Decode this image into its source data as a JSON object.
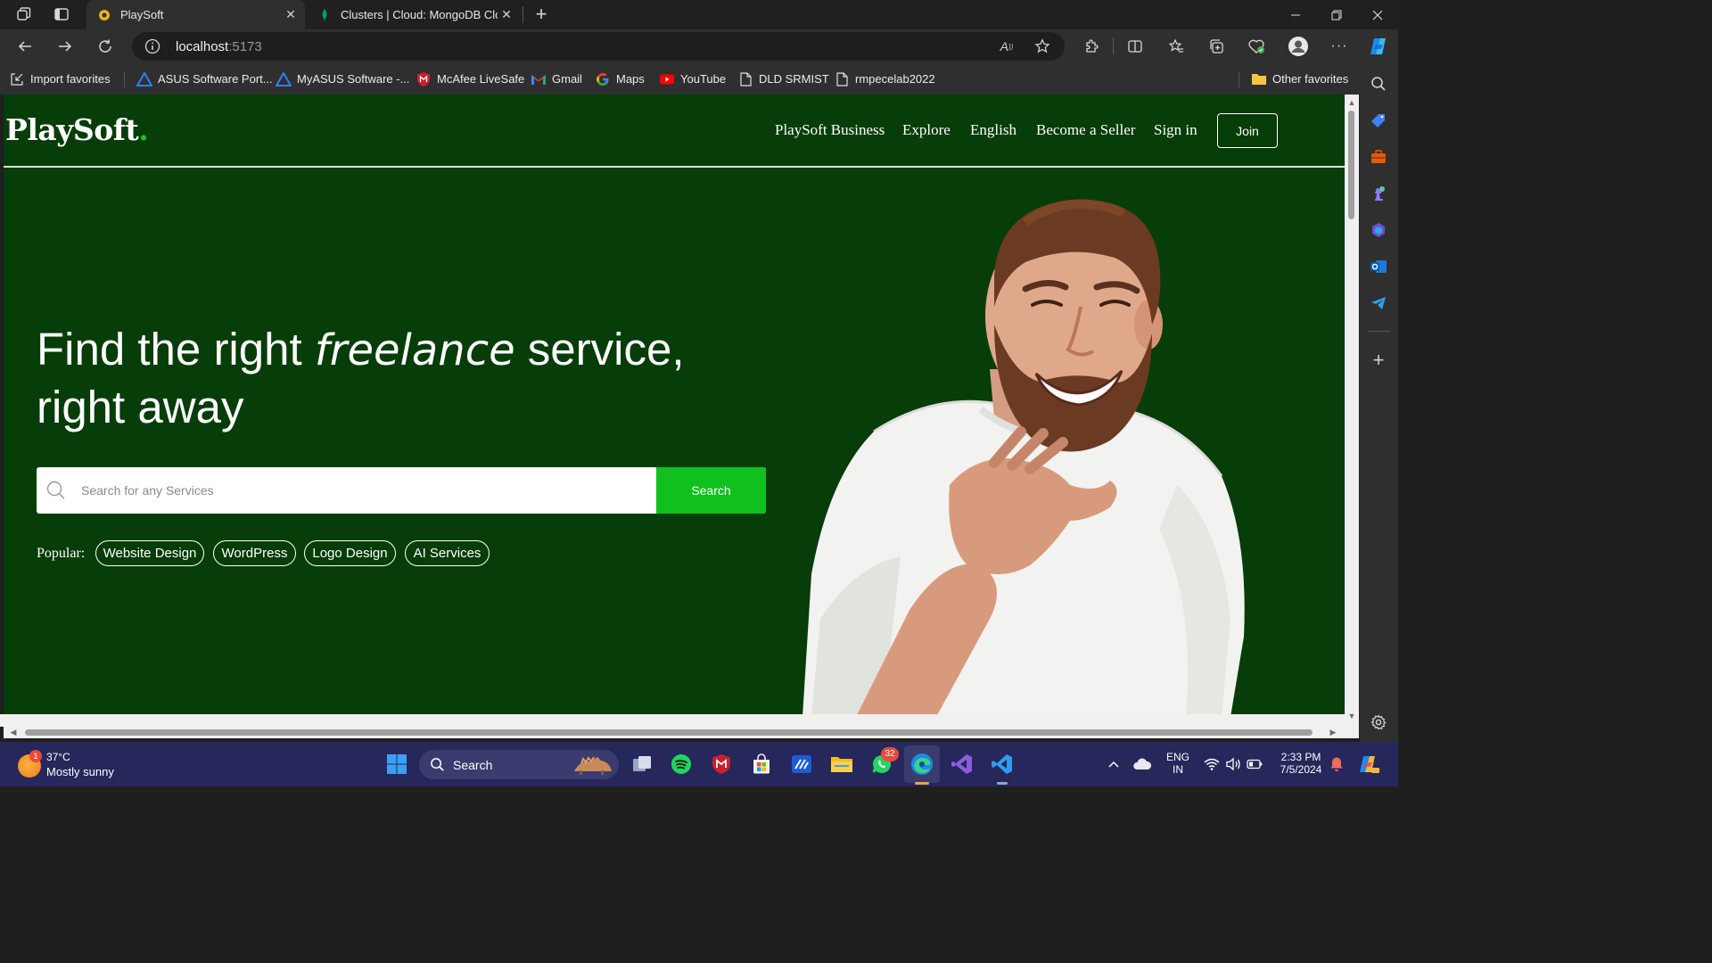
{
  "browser": {
    "tabs": [
      {
        "title": "PlaySoft",
        "active": true
      },
      {
        "title": "Clusters | Cloud: MongoDB Cloud",
        "active": false
      }
    ],
    "address": {
      "host": "localhost",
      "port": ":5173"
    },
    "favorites": [
      "Import favorites",
      "ASUS Software Port...",
      "MyASUS Software -...",
      "McAfee LiveSafe",
      "Gmail",
      "Maps",
      "YouTube",
      "DLD SRMIST",
      "rmpecelab2022"
    ],
    "other_favorites": "Other favorites",
    "read_aloud_glyph": "A"
  },
  "site": {
    "logo_text": "PlaySoft",
    "logo_dot": ".",
    "nav": [
      "PlaySoft Business",
      "Explore",
      "English",
      "Become a Seller",
      "Sign in"
    ],
    "join_label": "Join",
    "hero": {
      "title_before": "Find the right ",
      "title_em": "freelance",
      "title_after": " service,",
      "title_line2": "right away"
    },
    "search": {
      "placeholder": "Search for any Services",
      "button_label": "Search"
    },
    "popular_label": "Popular:",
    "popular_tags": [
      "Website Design",
      "WordPress",
      "Logo Design",
      "AI Services"
    ]
  },
  "taskbar": {
    "weather_temp": "37°C",
    "weather_desc": "Mostly sunny",
    "weather_badge": "1",
    "search_label": "Search",
    "whatsapp_badge": "32",
    "lang_line1": "ENG",
    "lang_line2": "IN",
    "time": "2:33 PM",
    "date": "7/5/2024"
  },
  "colors": {
    "page_bg": "#063d08",
    "accent_green": "#0fc01f",
    "logo_dot": "#1dbf2e",
    "taskbar": "#26275a"
  }
}
